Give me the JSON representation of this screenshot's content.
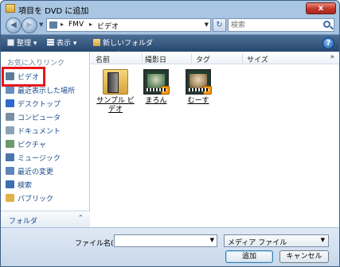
{
  "window": {
    "title": "項目を DVD に追加",
    "close_label": "x"
  },
  "address": {
    "segments": [
      "FMV",
      "ビデオ"
    ]
  },
  "search": {
    "placeholder": "検索"
  },
  "toolbar": {
    "organize": "整理",
    "views": "表示",
    "new_folder": "新しいフォルダ",
    "help": "?"
  },
  "nav": {
    "favorites_header": "お気に入りリンク",
    "items": [
      {
        "label": "ビデオ",
        "icon": "video-folder-icon"
      },
      {
        "label": "最近表示した場所",
        "icon": "recent-places-icon"
      },
      {
        "label": "デスクトップ",
        "icon": "desktop-icon"
      },
      {
        "label": "コンピュータ",
        "icon": "computer-icon"
      },
      {
        "label": "ドキュメント",
        "icon": "documents-icon"
      },
      {
        "label": "ピクチャ",
        "icon": "pictures-icon"
      },
      {
        "label": "ミュージック",
        "icon": "music-icon"
      },
      {
        "label": "最近の変更",
        "icon": "recent-changes-icon"
      },
      {
        "label": "検索",
        "icon": "search-folder-icon"
      },
      {
        "label": "パブリック",
        "icon": "public-folder-icon"
      }
    ],
    "folders_label": "フォルダ"
  },
  "columns": {
    "name": "名前",
    "date": "撮影日",
    "tags": "タグ",
    "size": "サイズ",
    "more": "»"
  },
  "files": [
    {
      "line1": "サンプル ビ",
      "line2": "デオ",
      "type": "folder"
    },
    {
      "line1": "まろん",
      "line2": "",
      "type": "video"
    },
    {
      "line1": "むーす",
      "line2": "",
      "type": "video"
    }
  ],
  "bottom": {
    "filename_label": "ファイル名(N):",
    "filename_value": "",
    "filetype_value": "メディア ファイル",
    "add_button": "追加",
    "cancel_button": "キャンセル"
  }
}
